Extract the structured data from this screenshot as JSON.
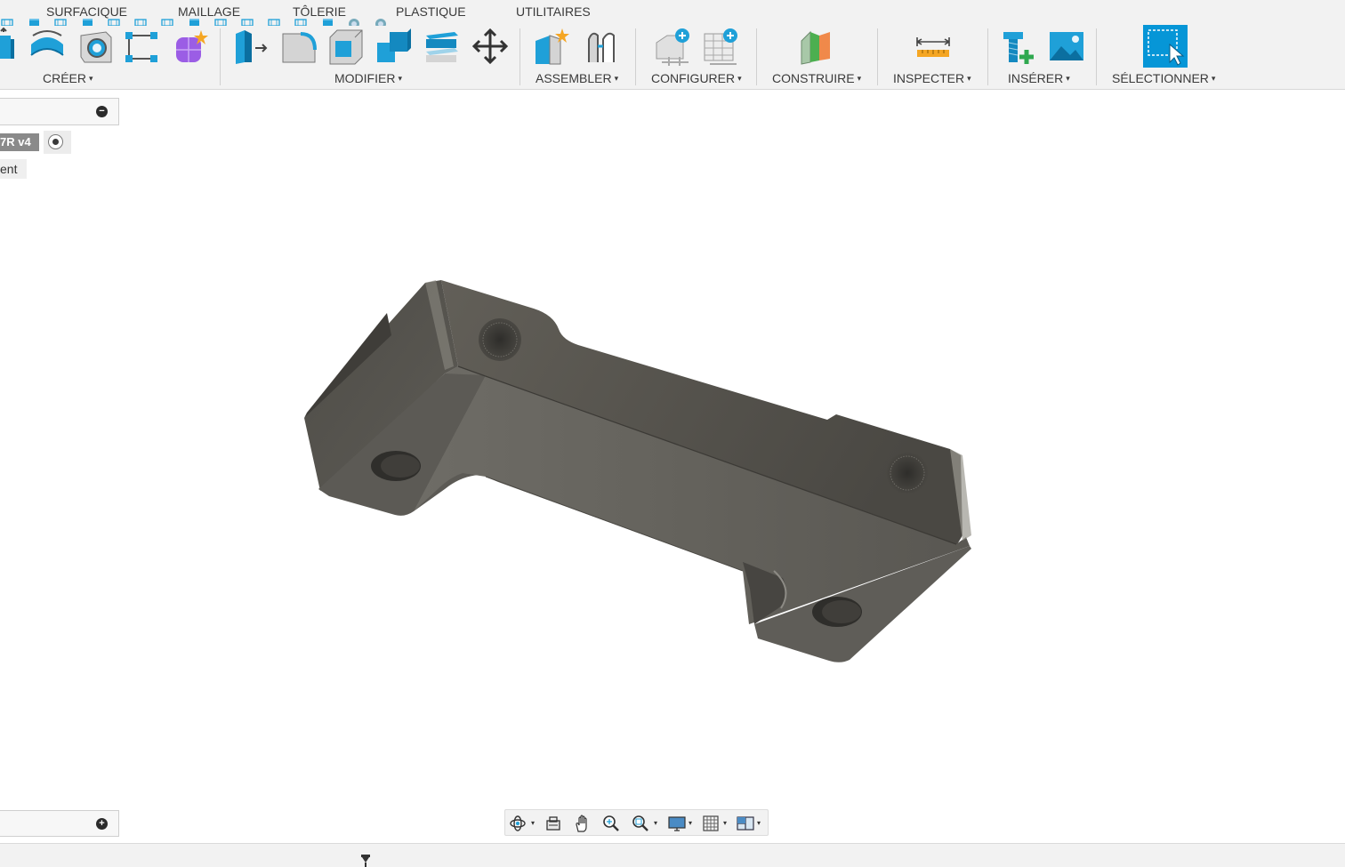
{
  "tabs": [
    {
      "label": "SURFACIQUE"
    },
    {
      "label": "MAILLAGE"
    },
    {
      "label": "TÔLERIE"
    },
    {
      "label": "PLASTIQUE"
    },
    {
      "label": "UTILITAIRES"
    }
  ],
  "toolbar": {
    "groups": [
      {
        "label": "CRÉER"
      },
      {
        "label": "MODIFIER"
      },
      {
        "label": "ASSEMBLER"
      },
      {
        "label": "CONFIGURER"
      },
      {
        "label": "CONSTRUIRE"
      },
      {
        "label": "INSPECTER"
      },
      {
        "label": "INSÉRER"
      },
      {
        "label": "SÉLECTIONNER"
      }
    ],
    "caret": "▾"
  },
  "browser": {
    "collapse_symbol": "−",
    "document_name": "7R v4",
    "item_label": "ent"
  },
  "comments": {
    "expand_symbol": "+"
  },
  "colors": {
    "accent_blue": "#1fa0d8",
    "select_blue": "#0696d7",
    "model_face": "#5e5c58",
    "model_dark": "#474541",
    "background": "#ffffff",
    "panel": "#f2f2f2"
  },
  "icons": {
    "create": [
      "extrude-icon",
      "revolve-icon",
      "hole-icon",
      "pattern-icon",
      "form-icon"
    ],
    "modify": [
      "press-pull-icon",
      "fillet-icon",
      "shell-icon",
      "combine-icon",
      "offset-face-icon",
      "move-icon"
    ],
    "assemble": [
      "new-component-icon",
      "joint-icon"
    ],
    "configure": [
      "configure-icon",
      "config-table-icon"
    ],
    "construct": [
      "construction-plane-icon"
    ],
    "inspect": [
      "measure-icon"
    ],
    "insert": [
      "insert-fastener-icon",
      "insert-image-icon"
    ],
    "select": [
      "select-window-icon"
    ],
    "navigation": [
      "orbit-icon",
      "look-at-icon",
      "pan-icon",
      "zoom-icon",
      "fit-icon",
      "display-icon",
      "grid-icon",
      "viewports-icon"
    ]
  }
}
